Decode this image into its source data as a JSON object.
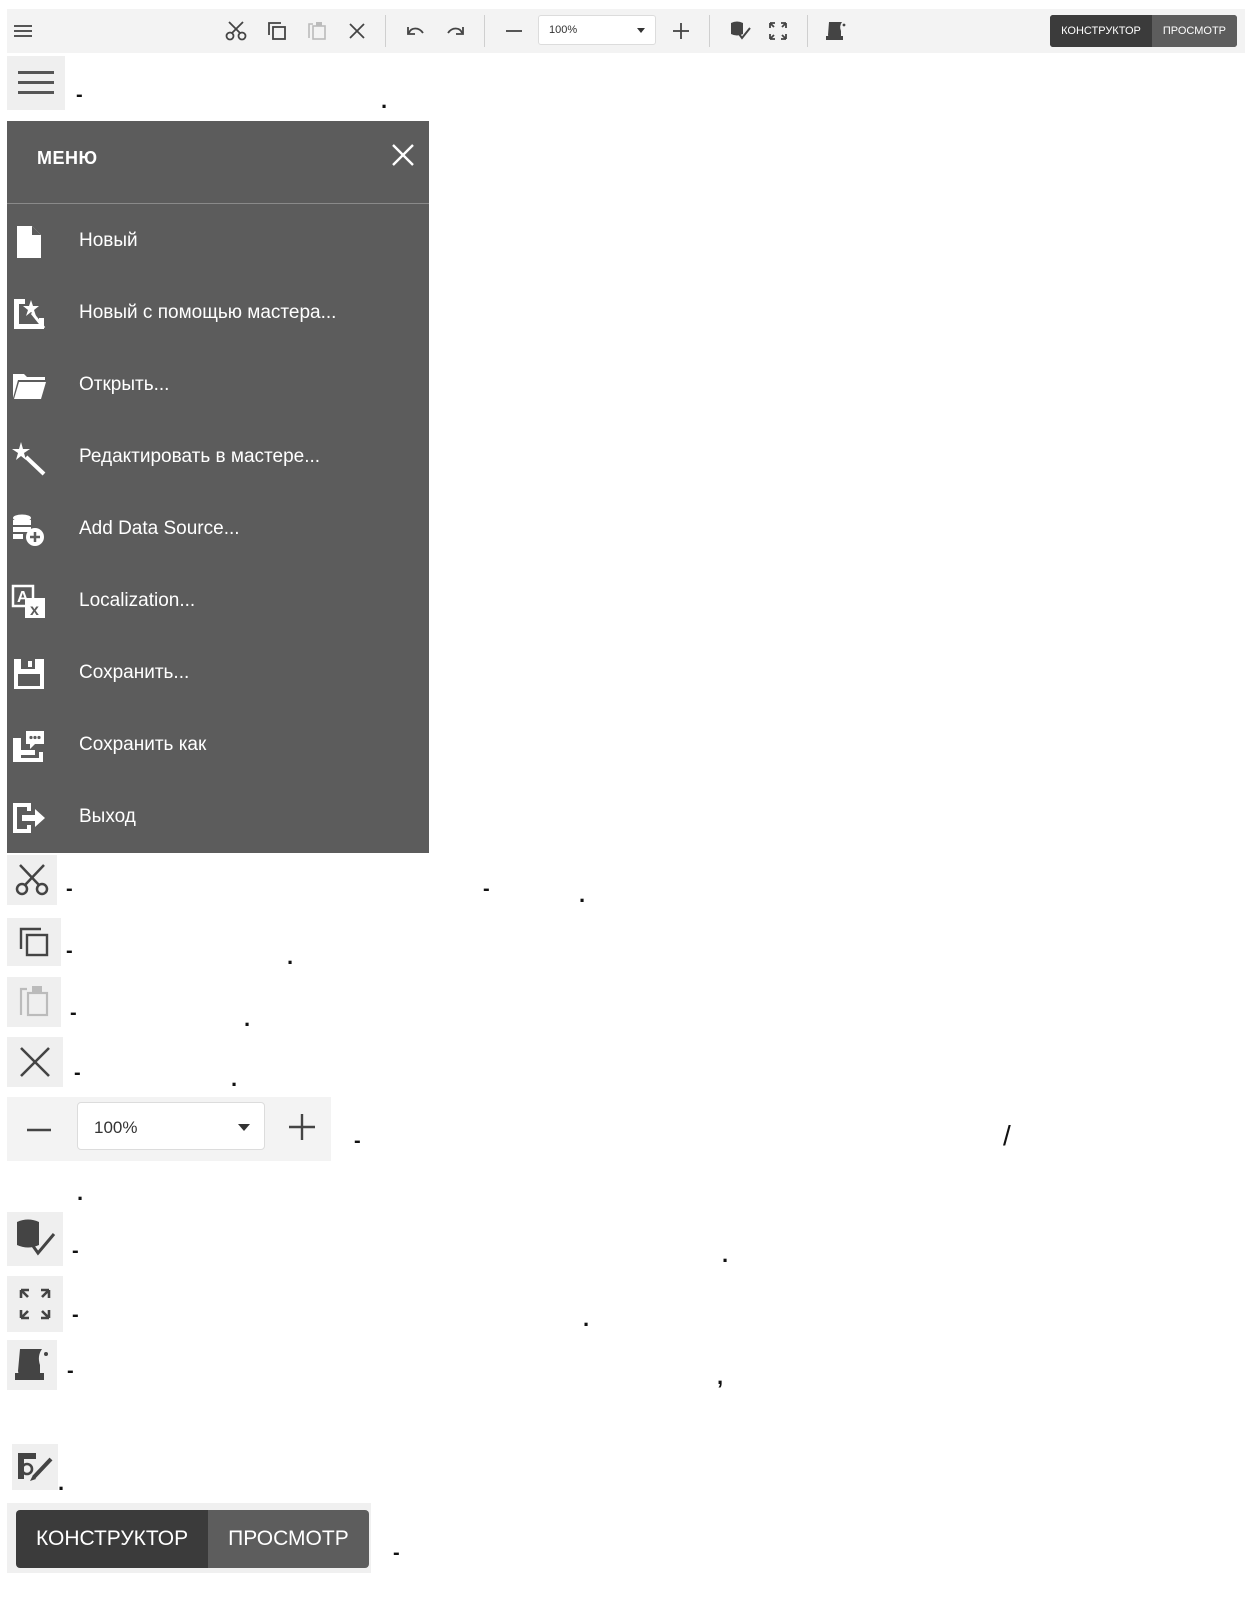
{
  "toolbar": {
    "zoom_value": "100%",
    "mode_designer": "КОНСТРУКТОР",
    "mode_preview": "ПРОСМОТР"
  },
  "menu": {
    "title": "МЕНЮ",
    "items": [
      {
        "label": "Новый",
        "icon": "new-file-icon"
      },
      {
        "label": "Новый с помощью мастера...",
        "icon": "wizard-new-icon"
      },
      {
        "label": "Открыть...",
        "icon": "folder-open-icon"
      },
      {
        "label": "Редактировать в мастере...",
        "icon": "magic-wand-icon"
      },
      {
        "label": "Add Data Source...",
        "icon": "add-data-source-icon"
      },
      {
        "label": "Localization...",
        "icon": "localization-icon"
      },
      {
        "label": "Сохранить...",
        "icon": "save-icon"
      },
      {
        "label": "Сохранить как",
        "icon": "save-as-icon"
      },
      {
        "label": "Выход",
        "icon": "exit-icon"
      }
    ]
  },
  "legend": {
    "menu_dash": "-",
    "menu_dot": ".",
    "cut_dash": "-",
    "cut_dash2": "-",
    "cut_dot": ".",
    "copy_dash": "-",
    "copy_dot": ".",
    "paste_dash": "-",
    "paste_dot": ".",
    "delete_dash": "-",
    "delete_dot": ".",
    "zoom_value": "100%",
    "zoom_dash": "-",
    "zoom_slash": "/",
    "zoom_dot": ".",
    "validate_dash": "-",
    "validate_dot": ".",
    "fullscreen_dash": "-",
    "fullscreen_dot": ".",
    "script_dash": "-",
    "script_comma": ",",
    "expression_dot": ".",
    "mode_designer": "КОНСТРУКТОР",
    "mode_preview": "ПРОСМОТР",
    "mode_dash": "-"
  },
  "colors": {
    "menu_bg": "#5c5c5c",
    "toolbar_bg": "#f3f3f3",
    "mode_active": "#3b3b3b",
    "mode_inactive": "#5d5d5d"
  }
}
